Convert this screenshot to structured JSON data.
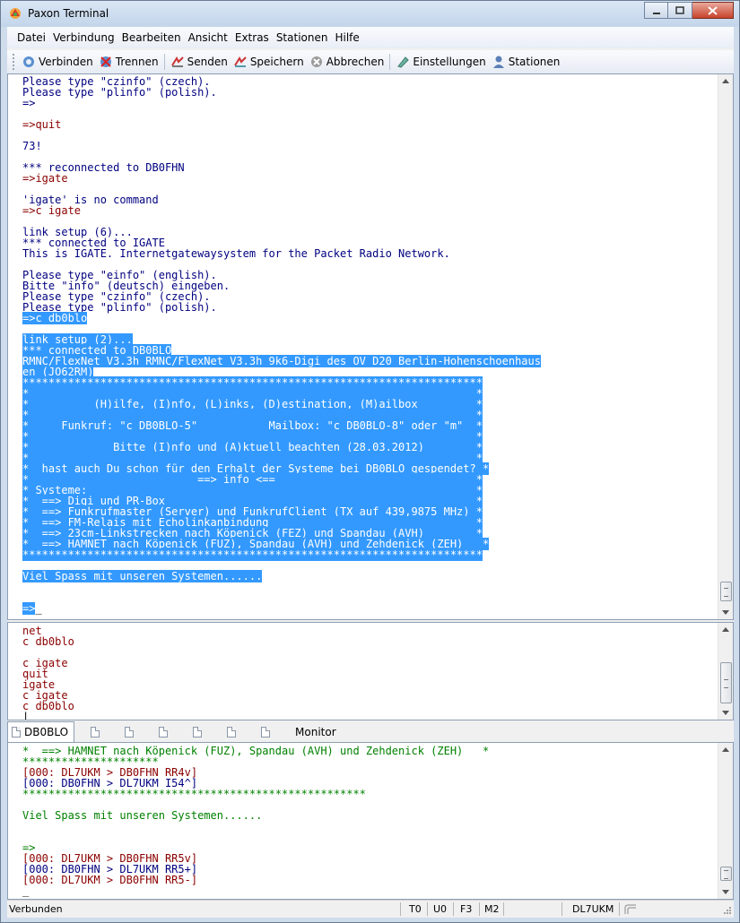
{
  "window": {
    "title": "Paxon Terminal",
    "controls": {
      "minimize": "–",
      "maximize": "□",
      "close": "✕"
    }
  },
  "menu": [
    "Datei",
    "Verbindung",
    "Bearbeiten",
    "Ansicht",
    "Extras",
    "Stationen",
    "Hilfe"
  ],
  "toolbar": {
    "connect": "Verbinden",
    "disconnect": "Trennen",
    "send": "Senden",
    "save": "Speichern",
    "abort": "Abbrechen",
    "settings": "Einstellungen",
    "stations": "Stationen"
  },
  "output_lines": [
    {
      "t": "Please type \"czinfo\" (czech).",
      "c": "blue"
    },
    {
      "t": "Please type \"plinfo\" (polish).",
      "c": "blue"
    },
    {
      "t": "=>",
      "c": "blue"
    },
    {
      "t": "",
      "c": "blue"
    },
    {
      "t": "=>quit",
      "c": "red"
    },
    {
      "t": "",
      "c": "blue"
    },
    {
      "t": "73!",
      "c": "blue"
    },
    {
      "t": "",
      "c": "blue"
    },
    {
      "t": "*** reconnected to DB0FHN",
      "c": "blue"
    },
    {
      "t": "=>igate",
      "c": "red"
    },
    {
      "t": "",
      "c": "blue"
    },
    {
      "t": "'igate' is no command",
      "c": "blue"
    },
    {
      "t": "=>c igate",
      "c": "red"
    },
    {
      "t": "",
      "c": "blue"
    },
    {
      "t": "link setup (6)...",
      "c": "blue"
    },
    {
      "t": "*** connected to IGATE",
      "c": "blue"
    },
    {
      "t": "This is IGATE. Internetgatewaysystem for the Packet Radio Network.",
      "c": "blue"
    },
    {
      "t": "",
      "c": "blue"
    },
    {
      "t": "Please type \"einfo\" (english).",
      "c": "blue"
    },
    {
      "t": "Bitte \"info\" (deutsch) eingeben.",
      "c": "blue"
    },
    {
      "t": "Please type \"czinfo\" (czech).",
      "c": "blue"
    },
    {
      "t": "Please type \"plinfo\" (polish).",
      "c": "blue"
    },
    {
      "t": "=>c db0blo",
      "c": "sel"
    },
    {
      "t": "",
      "c": "sel"
    },
    {
      "t": "link setup (2)...",
      "c": "sel"
    },
    {
      "t": "*** connected to DB0BLO",
      "c": "sel"
    },
    {
      "t": "RMNC/FlexNet V3.3h RMNC/FlexNet V3.3h 9k6-Digi des OV D20 Berlin-Hohenschoenhaus",
      "c": "sel"
    },
    {
      "t": "en (JO62RM)",
      "c": "sel"
    },
    {
      "t": "***********************************************************************",
      "c": "sel"
    },
    {
      "t": "*                                                                     *",
      "c": "sel"
    },
    {
      "t": "*          (H)ilfe, (I)nfo, (L)inks, (D)estination, (M)ailbox         *",
      "c": "sel"
    },
    {
      "t": "*                                                                     *",
      "c": "sel"
    },
    {
      "t": "*     Funkruf: \"c DB0BLO-5\"           Mailbox: \"c DB0BLO-8\" oder \"m\"  *",
      "c": "sel"
    },
    {
      "t": "*                                                                     *",
      "c": "sel"
    },
    {
      "t": "*             Bitte (I)nfo und (A)ktuell beachten (28.03.2012)        *",
      "c": "sel"
    },
    {
      "t": "*                                                                     *",
      "c": "sel"
    },
    {
      "t": "*  hast auch Du schon für den Erhalt der Systeme bei DB0BLO gespendet? *",
      "c": "sel"
    },
    {
      "t": "*                          ==> info <==                               *",
      "c": "sel"
    },
    {
      "t": "* Systeme:                                                            *",
      "c": "sel"
    },
    {
      "t": "*  ==> Digi und PR-Box                                                *",
      "c": "sel"
    },
    {
      "t": "*  ==> Funkrufmaster (Server) und FunkrufClient (TX auf 439,9875 MHz) *",
      "c": "sel"
    },
    {
      "t": "*  ==> FM-Relais mit Echolinkanbindung                                *",
      "c": "sel"
    },
    {
      "t": "*  ==> 23cm-Linkstrecken nach Köpenick (FEZ) und Spandau (AVH)        *",
      "c": "sel"
    },
    {
      "t": "*  ==> HAMNET nach Köpenick (FUZ), Spandau (AVH) und Zehdenick (ZEH)   *",
      "c": "sel"
    },
    {
      "t": "***********************************************************************",
      "c": "sel"
    },
    {
      "t": "",
      "c": "sel"
    },
    {
      "t": "Viel Spass mit unseren Systemen......",
      "c": "sel"
    },
    {
      "t": "",
      "c": "sel"
    },
    {
      "t": "",
      "c": "sel"
    },
    {
      "t": "=>",
      "c": "sel",
      "cursor": "_"
    }
  ],
  "input_lines": [
    "net",
    "c db0blo",
    "",
    "c igate",
    "quit",
    "igate",
    "c igate",
    "c db0blo"
  ],
  "tabs": [
    "DB0BLO",
    "",
    "",
    "",
    "",
    "",
    "",
    "Monitor"
  ],
  "monitor_lines": [
    {
      "t": "*  ==> HAMNET nach Köpenick (FUZ), Spandau (AVH) und Zehdenick (ZEH)   *",
      "c": "green"
    },
    {
      "t": "*********************",
      "c": "green"
    },
    {
      "t": "[000: DL7UKM > DB0FHN RR4v]",
      "c": "red"
    },
    {
      "t": "[000: DB0FHN > DL7UKM I54^]",
      "c": "blue"
    },
    {
      "t": "*****************************************************",
      "c": "green"
    },
    {
      "t": "",
      "c": "green"
    },
    {
      "t": "Viel Spass mit unseren Systemen......",
      "c": "green"
    },
    {
      "t": "",
      "c": "green"
    },
    {
      "t": "",
      "c": "green"
    },
    {
      "t": "=>",
      "c": "green"
    },
    {
      "t": "[000: DL7UKM > DB0FHN RR5v]",
      "c": "red"
    },
    {
      "t": "[000: DB0FHN > DL7UKM RR5+]",
      "c": "blue"
    },
    {
      "t": "[000: DL7UKM > DB0FHN RR5-]",
      "c": "red"
    },
    {
      "t": "_",
      "c": "black"
    }
  ],
  "status": {
    "state": "Verbunden",
    "t": "T0",
    "u": "U0",
    "f": "F3",
    "m": "M2",
    "call": "DL7UKM"
  },
  "colors": {
    "selection": "#3399ff",
    "incoming_text": "#000080",
    "own_text": "#8b0000",
    "monitor_green": "#008000"
  }
}
